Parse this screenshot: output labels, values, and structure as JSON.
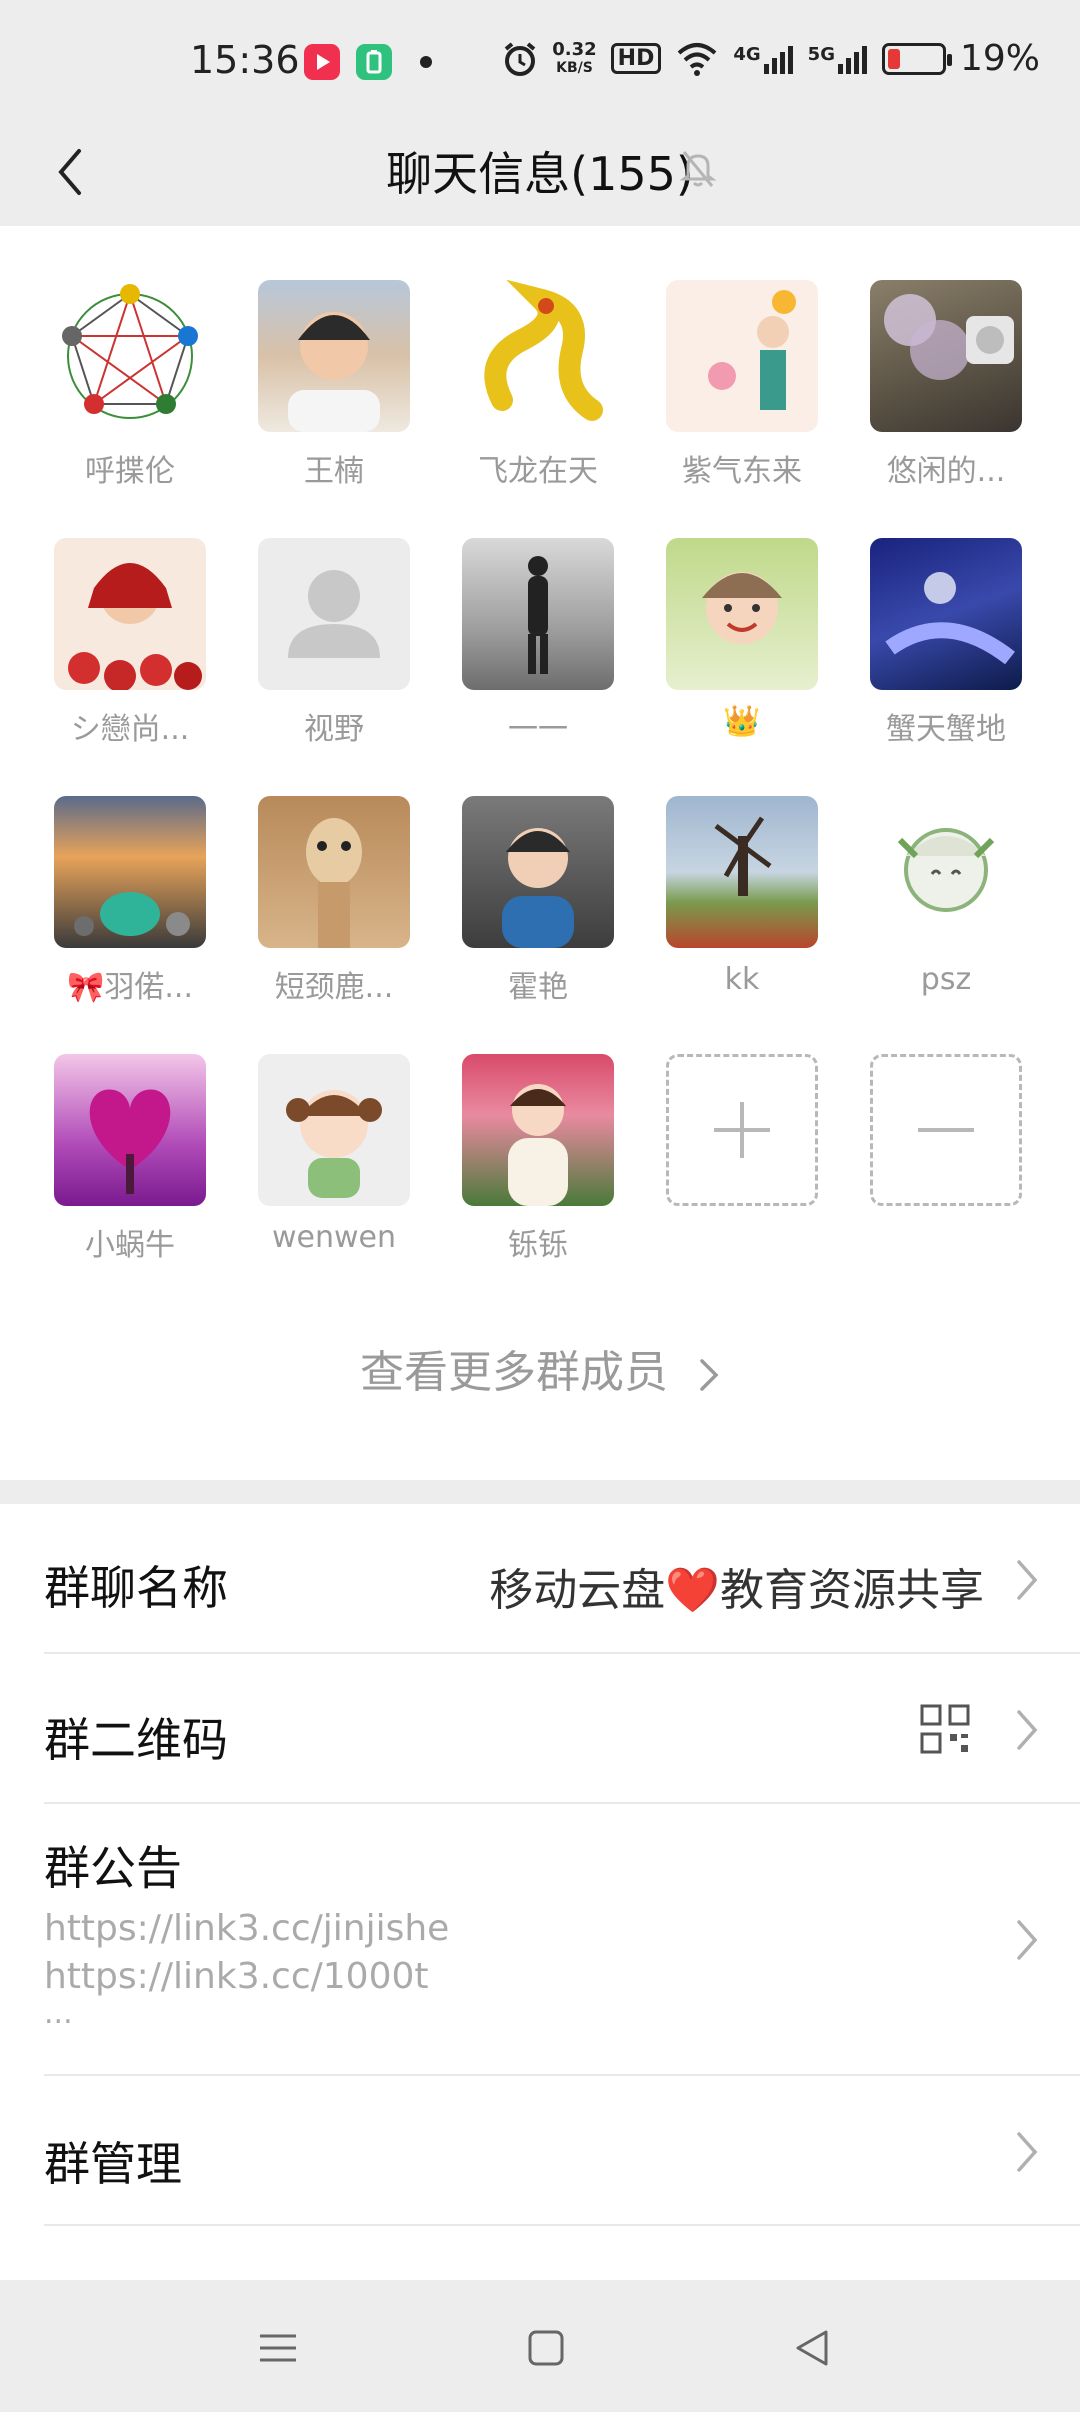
{
  "status_bar": {
    "time": "15:36",
    "speed_value": "0.32",
    "speed_unit": "KB/S",
    "hd_badge": "HD",
    "net_4g": "4G",
    "net_5g": "5G",
    "battery_percent": "19%",
    "battery_level": 0.19
  },
  "header": {
    "title": "聊天信息(155)"
  },
  "members": [
    {
      "name": "呼揲伦"
    },
    {
      "name": "王楠"
    },
    {
      "name": "飞龙在天"
    },
    {
      "name": "紫气东来"
    },
    {
      "name": "悠闲的..."
    },
    {
      "name": "シ戀尚..."
    },
    {
      "name": "视野"
    },
    {
      "name": "一一"
    },
    {
      "name": "👑"
    },
    {
      "name": "蟹天蟹地"
    },
    {
      "name": "🎀羽偌..."
    },
    {
      "name": "短颈鹿..."
    },
    {
      "name": "霍艳"
    },
    {
      "name": "kk"
    },
    {
      "name": "psz"
    },
    {
      "name": "小蜗牛"
    },
    {
      "name": "wenwen"
    },
    {
      "name": "铄铄"
    }
  ],
  "more_members_label": "查看更多群成员",
  "settings": {
    "group_name_label": "群聊名称",
    "group_name_value_part1": "移动云盘",
    "group_name_heart": "❤️",
    "group_name_value_part2": "教育资源共享",
    "qr_label": "群二维码",
    "notice_label": "群公告",
    "notice_line1": "https://link3.cc/jinjishe",
    "notice_line2": "https://link3.cc/1000t",
    "notice_line3": "...",
    "manage_label": "群管理"
  },
  "colors": {
    "background": "#ededed",
    "panel": "#ffffff",
    "muted_text": "#9a9a9a",
    "battery_low": "#e53935",
    "status_app_red": "#f0304e",
    "status_app_green": "#2ec27e"
  }
}
